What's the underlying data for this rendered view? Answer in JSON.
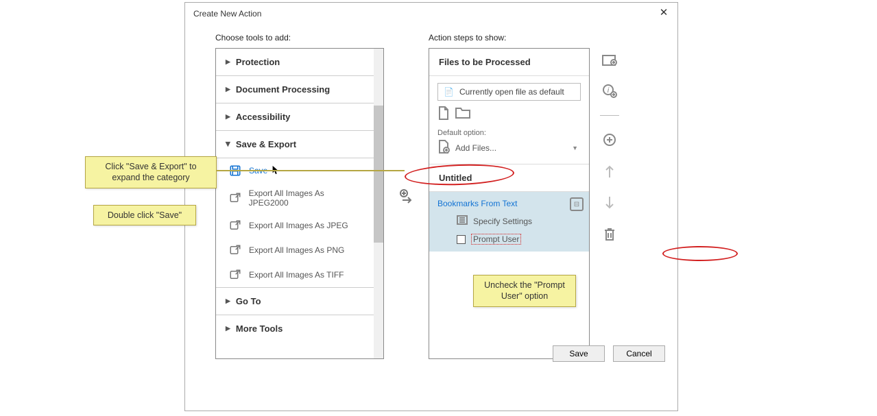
{
  "dialog": {
    "title": "Create New Action",
    "choose_label": "Choose tools to add:",
    "steps_label": "Action steps to show:"
  },
  "categories": {
    "protection": "Protection",
    "docproc": "Document Processing",
    "accessibility": "Accessibility",
    "saveexport": "Save & Export",
    "goto": "Go To",
    "moretools": "More Tools"
  },
  "tools": {
    "save": "Save",
    "jp2000": "Export All Images As JPEG2000",
    "jpeg": "Export All Images As JPEG",
    "png": "Export All Images As PNG",
    "tiff": "Export All Images As TIFF"
  },
  "right": {
    "files_header": "Files to be Processed",
    "current_open": "Currently open file as default",
    "default_option": "Default option:",
    "add_files": "Add Files...",
    "untitled": "Untitled"
  },
  "step": {
    "name": "Bookmarks From Text",
    "specify": "Specify Settings",
    "prompt": "Prompt User"
  },
  "buttons": {
    "save": "Save",
    "cancel": "Cancel"
  },
  "callouts": {
    "c1": "Click \"Save & Export\" to expand the category",
    "c2": "Double click \"Save\"",
    "c3": "Uncheck the \"Prompt User\" option"
  }
}
